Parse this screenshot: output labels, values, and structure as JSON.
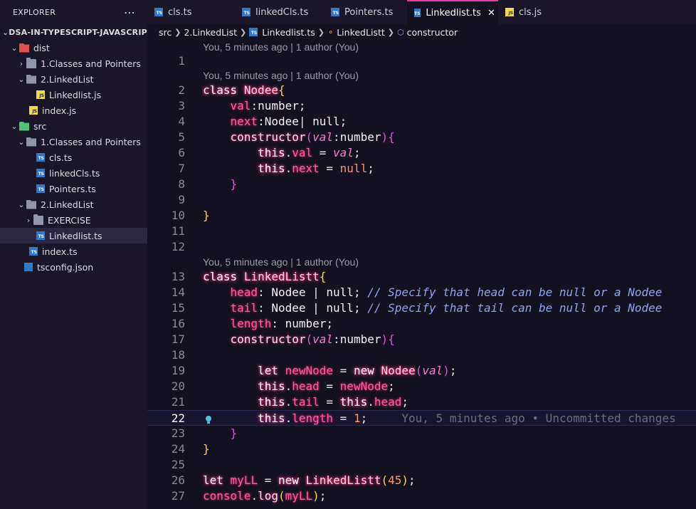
{
  "sidebar": {
    "title": "EXPLORER",
    "more": "⋯",
    "root": "DSA-IN-TYPESCRIPT-JAVASCRIPT",
    "items": [
      {
        "label": "dist"
      },
      {
        "label": "1.Classes and Pointers"
      },
      {
        "label": "2.LinkedList"
      },
      {
        "label": "Linkedlist.js"
      },
      {
        "label": "index.js"
      },
      {
        "label": "src"
      },
      {
        "label": "1.Classes and Pointers"
      },
      {
        "label": "cls.ts"
      },
      {
        "label": "linkedCls.ts"
      },
      {
        "label": "Pointers.ts"
      },
      {
        "label": "2.LinkedList"
      },
      {
        "label": "EXERCISE"
      },
      {
        "label": "Linkedlist.ts"
      },
      {
        "label": "index.ts"
      },
      {
        "label": "tsconfig.json"
      }
    ]
  },
  "tabs": [
    {
      "label": "cls.ts",
      "icon": "ts-icon"
    },
    {
      "label": "linkedCls.ts",
      "icon": "ts-icon"
    },
    {
      "label": "Pointers.ts",
      "icon": "ts-icon"
    },
    {
      "label": "Linkedlist.ts",
      "icon": "ts-icon"
    },
    {
      "label": "cls.js",
      "icon": "js-icon"
    }
  ],
  "tab_close": "✕",
  "breadcrumb": {
    "src": "src",
    "folder": "2.LinkedList",
    "file": "Linkedlist.ts",
    "class": "LinkedListt",
    "method": "constructor"
  },
  "editor": {
    "blame": "You, 5 minutes ago | 1 author (You)",
    "inline_blame": "You, 5 minutes ago • Uncommitted changes",
    "line_numbers": [
      "1",
      "2",
      "3",
      "4",
      "5",
      "6",
      "7",
      "8",
      "9",
      "10",
      "11",
      "12",
      "13",
      "14",
      "15",
      "16",
      "17",
      "18",
      "19",
      "20",
      "21",
      "22",
      "23",
      "24",
      "25",
      "26",
      "27"
    ],
    "comment1": "// Specify that head can be null or a Nodee",
    "comment2": "// Specify that tail can be null or a Nodee"
  },
  "colors": {
    "accent": "#e83aa8",
    "keyword": "#ff3a8c",
    "comment": "#8fa3f0"
  }
}
